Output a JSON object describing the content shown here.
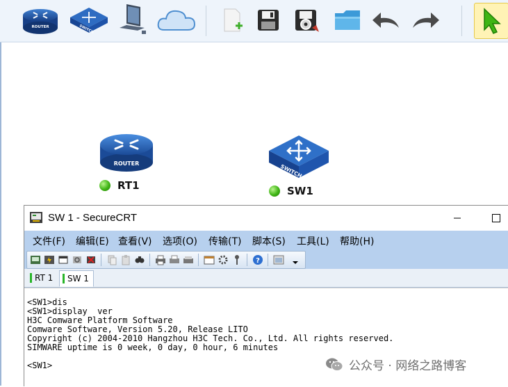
{
  "palette": {
    "items": [
      {
        "name": "router",
        "label": "ROUTER"
      },
      {
        "name": "switch",
        "label": "SWITCH"
      },
      {
        "name": "pc",
        "label": ""
      },
      {
        "name": "cloud",
        "label": ""
      },
      {
        "name": "new-file",
        "label": ""
      },
      {
        "name": "save",
        "label": ""
      },
      {
        "name": "save-as",
        "label": ""
      },
      {
        "name": "open-folder",
        "label": ""
      },
      {
        "name": "undo",
        "label": ""
      },
      {
        "name": "redo",
        "label": ""
      },
      {
        "name": "select-pointer",
        "label": ""
      }
    ]
  },
  "topology": {
    "devices": [
      {
        "name": "RT1",
        "type": "router",
        "badge": "ROUTER",
        "status": "up",
        "status_color": "#3fb515"
      },
      {
        "name": "SW1",
        "type": "switch",
        "badge": "SWITCH",
        "status": "up",
        "status_color": "#3fb515"
      }
    ]
  },
  "crt": {
    "title": "SW 1 - SecureCRT",
    "menu": [
      "文件(F)",
      "编辑(E)",
      "查看(V)",
      "选项(O)",
      "传输(T)",
      "脚本(S)",
      "工具(L)",
      "帮助(H)"
    ],
    "tabs": [
      {
        "label": "RT 1",
        "active": false
      },
      {
        "label": "SW 1",
        "active": true
      }
    ],
    "terminal_lines": [
      "<SW1>dis",
      "<SW1>display  ver",
      "H3C Comware Platform Software",
      "Comware Software, Version 5.20, Release LITO",
      "Copyright (c) 2004-2010 Hangzhou H3C Tech. Co., Ltd. All rights reserved.",
      "SIMWARE uptime is 0 week, 0 day, 0 hour, 6 minutes",
      "",
      "<SW1>"
    ]
  },
  "watermark": {
    "text": "公众号 · 网络之路博客"
  },
  "colors": {
    "menubar_bg": "#b7d0ee",
    "status_led": "#3fb515",
    "device_blue": "#1f5fb0"
  }
}
